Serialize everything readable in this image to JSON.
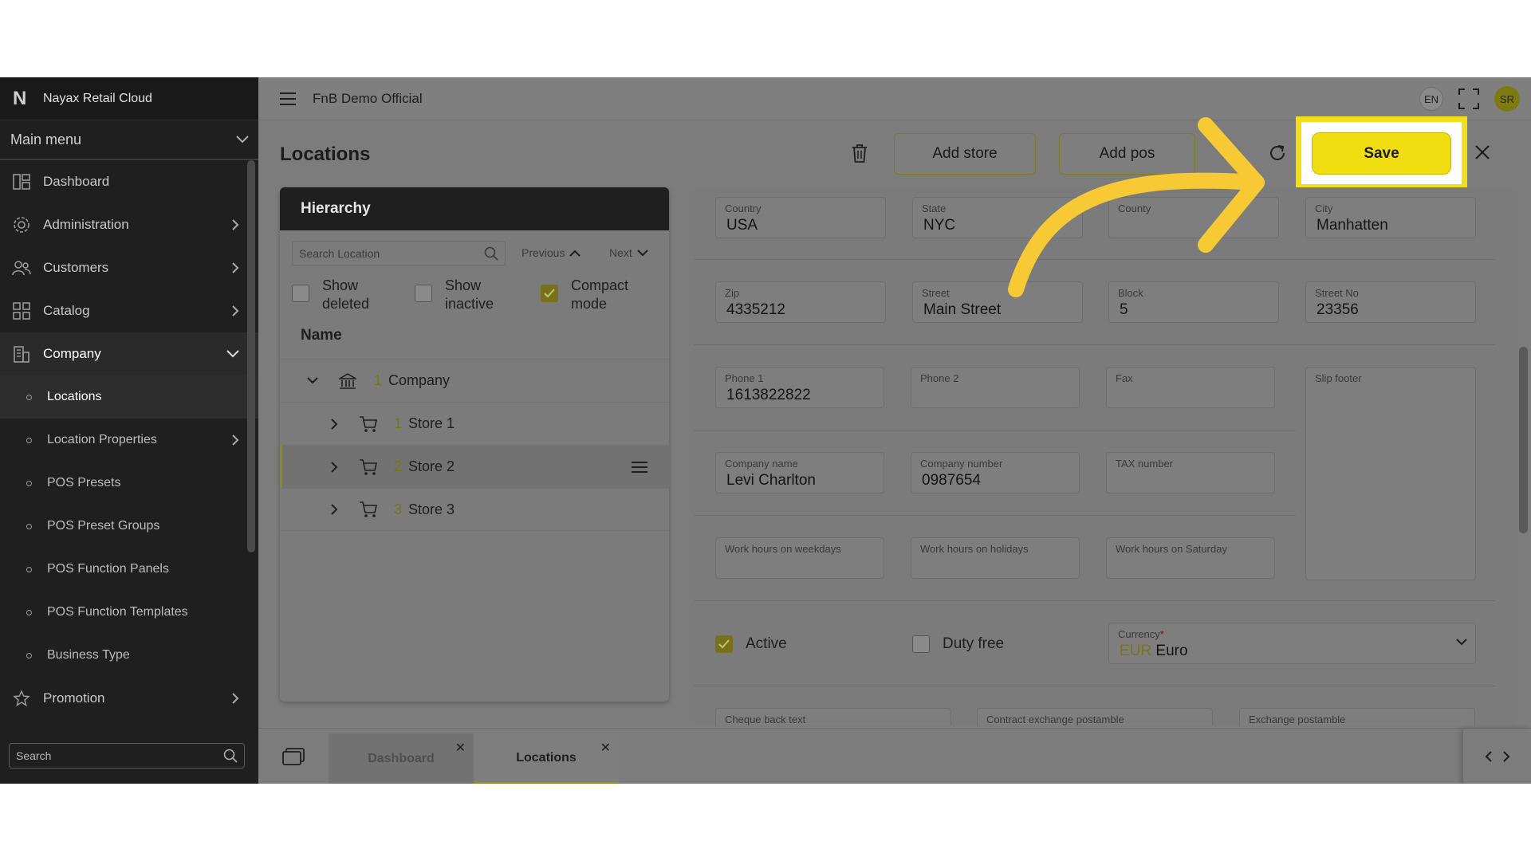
{
  "app": {
    "brand": "Nayax Retail Cloud",
    "org": "FnB Demo Official",
    "lang": "EN",
    "user_initials": "SR"
  },
  "sidebar": {
    "main_menu": "Main menu",
    "items": [
      {
        "label": "Dashboard",
        "icon": "dashboard-icon"
      },
      {
        "label": "Administration",
        "icon": "gear-icon"
      },
      {
        "label": "Customers",
        "icon": "users-icon"
      },
      {
        "label": "Catalog",
        "icon": "grid-icon"
      },
      {
        "label": "Company",
        "icon": "building-icon"
      }
    ],
    "sub_items": [
      {
        "label": "Locations"
      },
      {
        "label": "Location Properties"
      },
      {
        "label": "POS Presets"
      },
      {
        "label": "POS Preset Groups"
      },
      {
        "label": "POS Function Panels"
      },
      {
        "label": "POS Function Templates"
      },
      {
        "label": "Business Type"
      }
    ],
    "promotion": "Promotion",
    "search_placeholder": "Search"
  },
  "page": {
    "title": "Locations",
    "add_store": "Add store",
    "add_pos": "Add pos",
    "save": "Save"
  },
  "hierarchy": {
    "title": "Hierarchy",
    "search_placeholder": "Search Location",
    "previous": "Previous",
    "next": "Next",
    "show_deleted": [
      "Show",
      "deleted"
    ],
    "show_inactive": [
      "Show",
      "inactive"
    ],
    "compact_mode": [
      "Compact",
      "mode"
    ],
    "column_name": "Name",
    "rows": [
      {
        "num": "1",
        "name": "Company"
      },
      {
        "num": "1",
        "name": "Store 1"
      },
      {
        "num": "2",
        "name": "Store 2"
      },
      {
        "num": "3",
        "name": "Store 3"
      }
    ]
  },
  "form": {
    "country": {
      "label": "Country",
      "value": "USA"
    },
    "state": {
      "label": "State",
      "value": "NYC"
    },
    "county": {
      "label": "County",
      "value": ""
    },
    "city": {
      "label": "City",
      "value": "Manhatten"
    },
    "zip": {
      "label": "Zip",
      "value": "4335212"
    },
    "street": {
      "label": "Street",
      "value": "Main Street"
    },
    "block": {
      "label": "Block",
      "value": "5"
    },
    "street_no": {
      "label": "Street No",
      "value": "23356"
    },
    "phone1": {
      "label": "Phone 1",
      "value": "1613822822"
    },
    "phone2": {
      "label": "Phone 2",
      "value": ""
    },
    "fax": {
      "label": "Fax",
      "value": ""
    },
    "slip_footer": {
      "label": "Slip footer",
      "value": ""
    },
    "company_name": {
      "label": "Company name",
      "value": "Levi Charlton"
    },
    "company_number": {
      "label": "Company number",
      "value": "0987654"
    },
    "tax_number": {
      "label": "TAX number",
      "value": ""
    },
    "work_weekdays": {
      "label": "Work hours on weekdays",
      "value": ""
    },
    "work_holidays": {
      "label": "Work hours on holidays",
      "value": ""
    },
    "work_saturday": {
      "label": "Work hours on Saturday",
      "value": ""
    },
    "active": "Active",
    "duty_free": "Duty free",
    "currency": {
      "label": "Currency",
      "required": "*",
      "code": "EUR",
      "name": "Euro"
    },
    "cheque_back": {
      "label": "Cheque back text"
    },
    "contract_exchange": {
      "label": "Contract exchange postamble"
    },
    "exchange_postamble": {
      "label": "Exchange postamble"
    }
  },
  "tabs": [
    {
      "label": "Dashboard"
    },
    {
      "label": "Locations"
    }
  ],
  "colors": {
    "accent": "#f1de12",
    "sidebar_bg": "#1f1f1f"
  }
}
